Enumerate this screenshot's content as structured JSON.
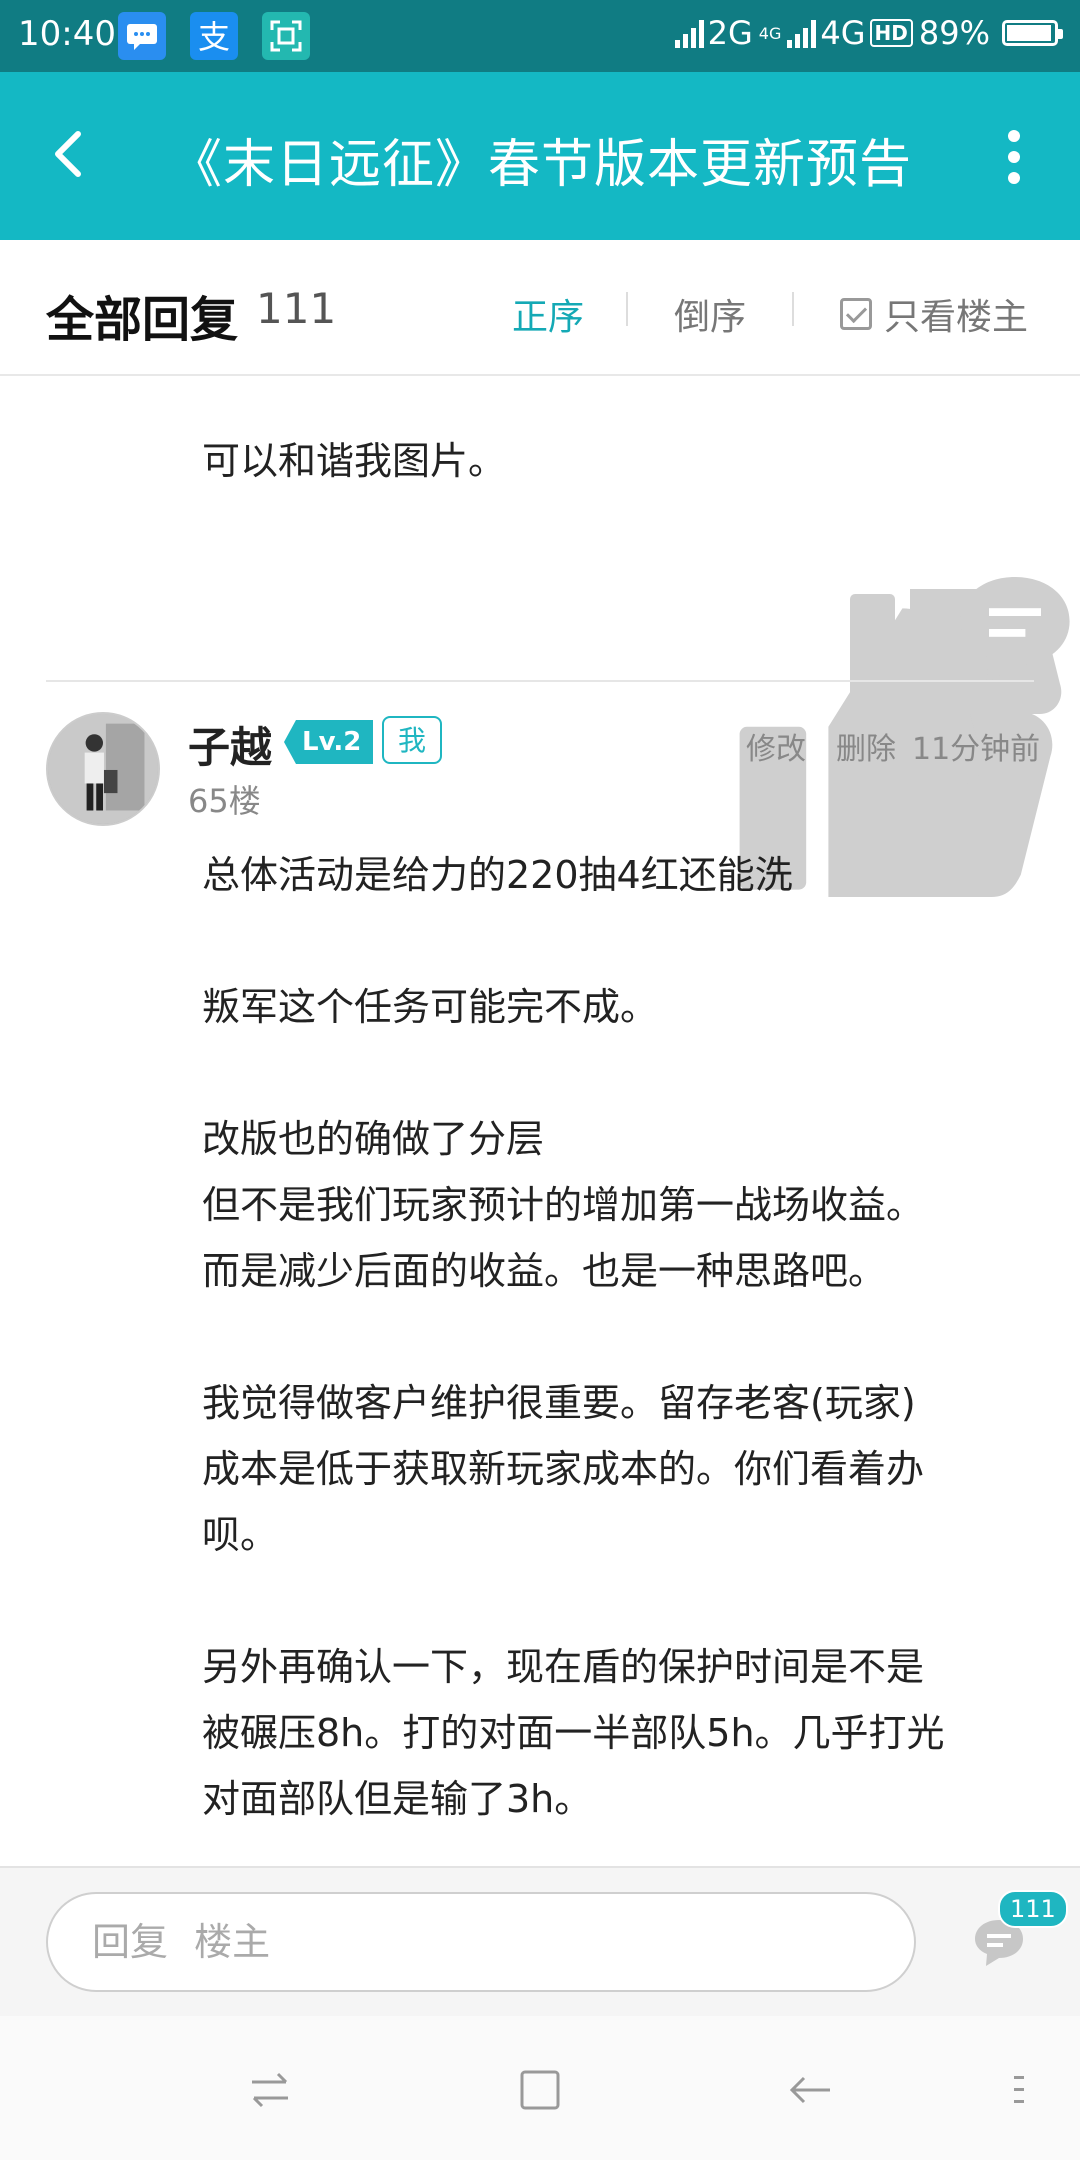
{
  "status_bar": {
    "time": "10:40",
    "network_1": "2G",
    "network_small": "4G",
    "network_2": "4G",
    "hd": "HD",
    "battery": "89%",
    "app_icons": [
      "message-icon",
      "alipay-icon",
      "scan-icon"
    ]
  },
  "header": {
    "title": "《末日远征》春节版本更新预告"
  },
  "sort_bar": {
    "all_replies": "全部回复",
    "count": "111",
    "ascending": "正序",
    "descending": "倒序",
    "owner_only": "只看楼主"
  },
  "previous_post": {
    "text": "可以和谐我图片。"
  },
  "post": {
    "username": "子越",
    "level": "Lv.2",
    "me_badge": "我",
    "edit": "修改",
    "delete": "删除",
    "time": "11分钟前",
    "floor": "65楼",
    "paragraphs": [
      "总体活动是给力的220抽4红还能洗",
      "叛军这个任务可能完不成。",
      "改版也的确做了分层",
      "但不是我们玩家预计的增加第一战场收益。",
      "而是减少后面的收益。也是一种思路吧。",
      "我觉得做客户维护很重要。留存老客(玩家)",
      "成本是低于获取新玩家成本的。你们看着办",
      "呗。",
      "另外再确认一下，现在盾的保护时间是不是",
      "被碾压8h。打的对面一半部队5h。几乎打光",
      "对面部队但是输了3h。"
    ]
  },
  "reply_bar": {
    "placeholder": "回复  楼主",
    "comment_count": "111"
  },
  "colors": {
    "accent": "#14b8c4",
    "status_bar": "#107c83"
  }
}
